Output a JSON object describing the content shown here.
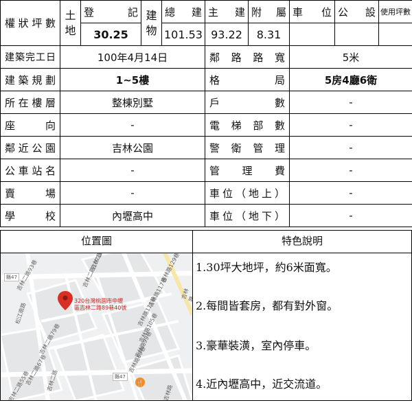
{
  "area": {
    "title": "權狀坪數",
    "land_label": [
      "土",
      "地"
    ],
    "reg_label": "登記",
    "reg_value": "30.25",
    "bldg_label": [
      "建",
      "物"
    ],
    "total_label": "總建",
    "total_value": "101.53",
    "main_label": "主建",
    "main_value": "93.22",
    "annex_label": "附屬",
    "annex_value": "8.31",
    "parking_label": "車位",
    "parking_value": "",
    "public_label": "公設",
    "public_value": "",
    "usage_label": "使用坪數",
    "usage_value": ""
  },
  "rows": [
    {
      "l1": "建築完工日",
      "v1": "100年4月14日",
      "l2": "鄰路路寬",
      "v2": "5米"
    },
    {
      "l1": "建築規劃",
      "v1": "1~5樓",
      "l2": "格局",
      "v2": "5房4廳6衛"
    },
    {
      "l1": "所在樓層",
      "v1": "整棟別墅",
      "l2": "戶數",
      "v2": "-"
    },
    {
      "l1": "座向",
      "v1": "-",
      "l2": "電梯部數",
      "v2": "-"
    },
    {
      "l1": "鄰近公園",
      "v1": "吉林公園",
      "l2": "警衛管理",
      "v2": "-"
    },
    {
      "l1": "公車站名",
      "v1": "-",
      "l2": "管理費",
      "v2": "-"
    },
    {
      "l1": "賣場",
      "v1": "-",
      "l2": "車位（地上）",
      "v2": "-"
    },
    {
      "l1": "學校",
      "v1": "內壢高中",
      "l2": "車位（地下）",
      "v2": "-"
    }
  ],
  "map_header": "位置圖",
  "features_header": "特色說明",
  "features": [
    "1.30坪大地坪，約6米面寬。",
    "2.每間皆套房，都有對外窗。",
    "3.豪華裝潢，室內停車。",
    "4.近內壢高中，近交流道。"
  ],
  "map": {
    "pin_text_1": "320台灣桃園市中壢",
    "pin_text_2": "區吉林二路89巷40號",
    "road_147_a": "縣47",
    "road_147_b": "縣47",
    "streets": [
      "吉林二路121巷",
      "吉林二路107巷",
      "吉林二路93巷",
      "吉林二路79巷",
      "吉林二路67巷",
      "吉林二路55巷",
      "吉林路129巷",
      "吉林路117巷",
      "吉林路111巷",
      "吉林路105巷",
      "吉林路99巷",
      "吉林路89巷",
      "吉林二路",
      "松江南路",
      "吉林路",
      "吉林路"
    ]
  }
}
